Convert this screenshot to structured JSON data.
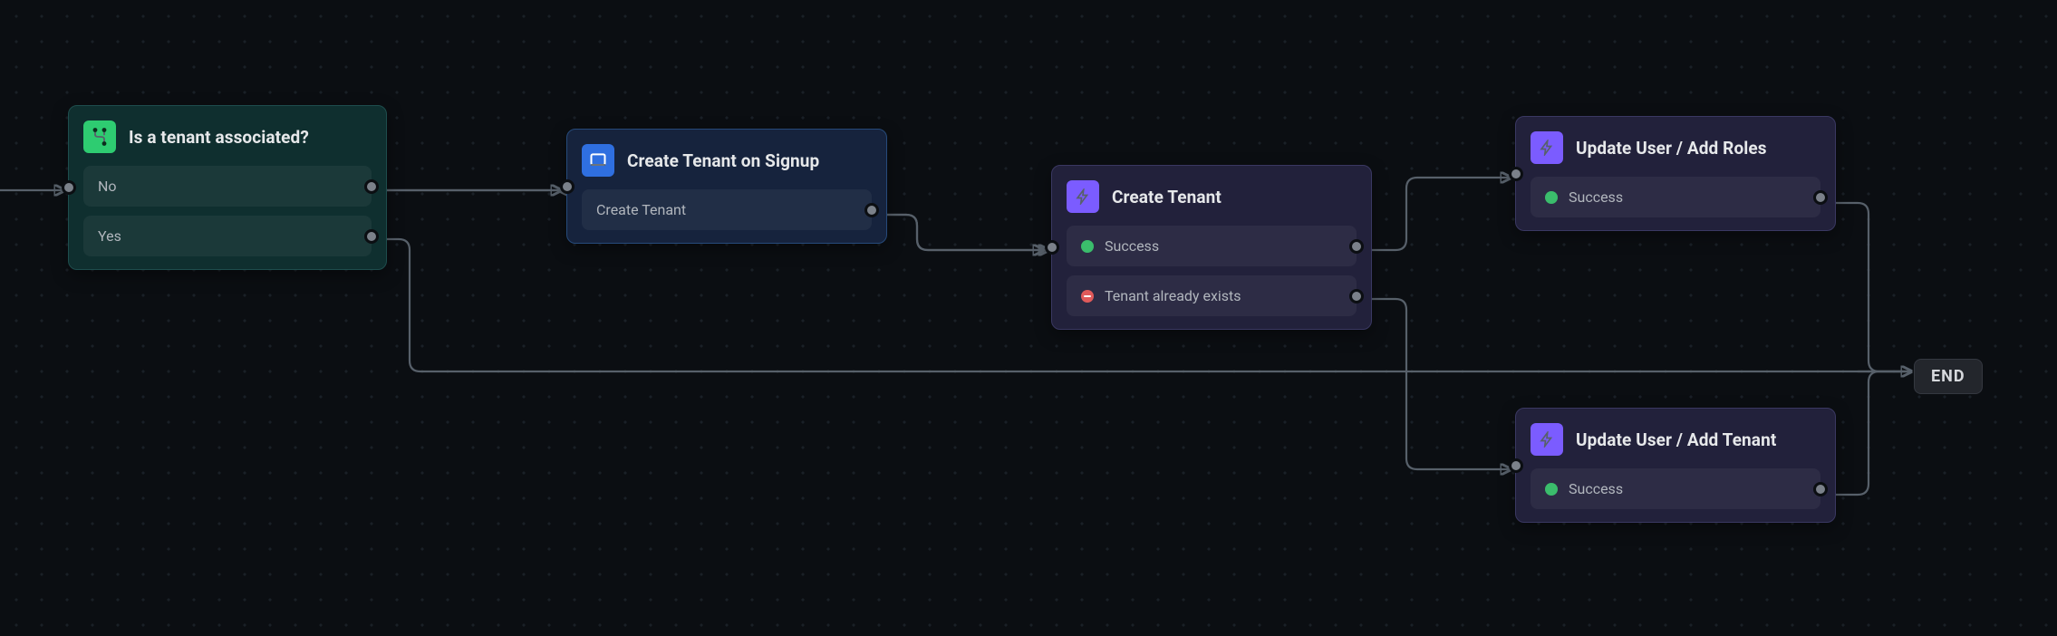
{
  "nodes": {
    "condition": {
      "title": "Is a tenant associated?",
      "icon": "branch-icon",
      "options": {
        "no": "No",
        "yes": "Yes"
      }
    },
    "signupForm": {
      "title": "Create Tenant on Signup",
      "icon": "form-icon",
      "outputs": {
        "createTenant": "Create Tenant"
      }
    },
    "createTenant": {
      "title": "Create Tenant",
      "icon": "bolt-icon",
      "outputs": {
        "success": "Success",
        "exists": "Tenant already exists"
      }
    },
    "updateRoles": {
      "title": "Update User / Add Roles",
      "icon": "bolt-icon",
      "outputs": {
        "success": "Success"
      }
    },
    "updateTenant": {
      "title": "Update User / Add Tenant",
      "icon": "bolt-icon",
      "outputs": {
        "success": "Success"
      }
    }
  },
  "end_label": "END",
  "flow_edges": [
    {
      "from": "start",
      "to": "condition"
    },
    {
      "from": "condition.no",
      "to": "signupForm"
    },
    {
      "from": "condition.yes",
      "to": "end"
    },
    {
      "from": "signupForm.createTenant",
      "to": "createTenant"
    },
    {
      "from": "createTenant.success",
      "to": "updateRoles"
    },
    {
      "from": "createTenant.exists",
      "to": "updateTenant"
    },
    {
      "from": "updateRoles.success",
      "to": "end"
    },
    {
      "from": "updateTenant.success",
      "to": "end"
    }
  ],
  "colors": {
    "accent_green": "#2ecc71",
    "accent_blue": "#2f6fe0",
    "accent_purple": "#7b5cff",
    "success": "#3bbd6c",
    "error": "#e05a5a",
    "connector": "#57606a"
  }
}
